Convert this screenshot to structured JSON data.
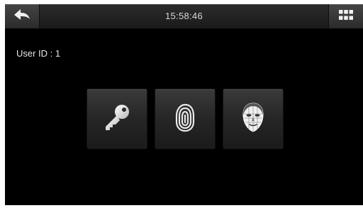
{
  "topbar": {
    "time": "15:58:46",
    "back_icon": "back-arrow-icon",
    "menu_icon": "grid-menu-icon"
  },
  "main": {
    "user_id_label": "User ID : 1"
  },
  "verification_methods": [
    {
      "name": "password",
      "icon": "key-icon"
    },
    {
      "name": "fingerprint",
      "icon": "fingerprint-icon"
    },
    {
      "name": "face",
      "icon": "face-icon"
    }
  ]
}
